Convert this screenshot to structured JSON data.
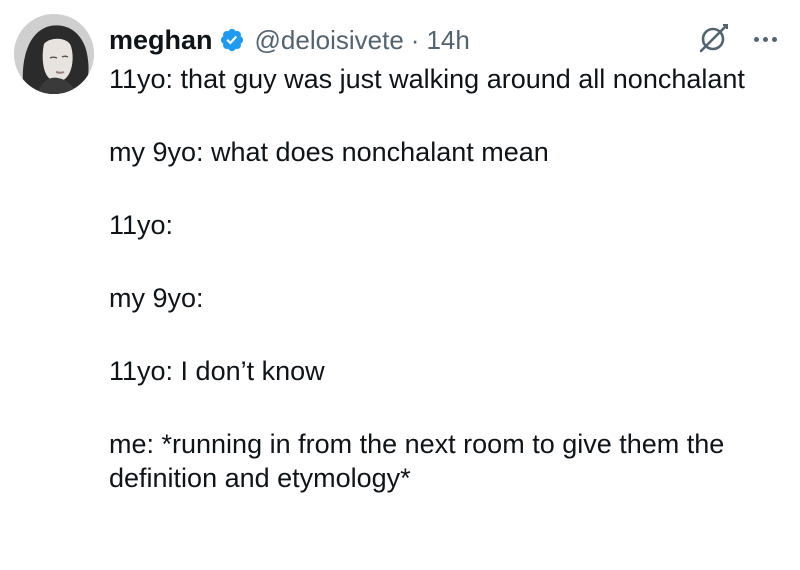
{
  "tweet": {
    "author": {
      "name": "meghan",
      "handle": "@deloisivete",
      "separator": "·",
      "time": "14h",
      "verified": true,
      "avatar_icon": "user-photo-avatar"
    },
    "icons": {
      "grok": "grok-icon",
      "more": "more-options-icon",
      "verified": "verified-badge-icon"
    },
    "paragraphs": [
      "11yo: that guy was just walking around all nonchalant",
      "my 9yo: what does nonchalant mean",
      "11yo:",
      "my 9yo:",
      "11yo: I don’t know",
      "me: *running in from the next room to give them the definition and etymology*"
    ],
    "colors": {
      "text": "#0f1419",
      "secondary": "#536471",
      "verified_badge": "#1d9bf0",
      "background": "#ffffff"
    }
  }
}
